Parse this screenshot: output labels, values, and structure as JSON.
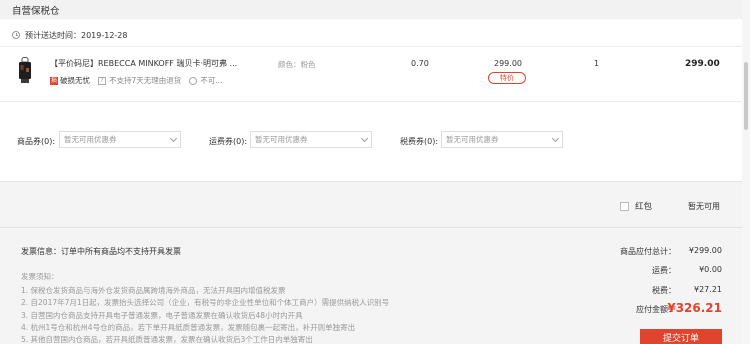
{
  "header": {
    "title": "自营保税仓"
  },
  "delivery": {
    "text": "预计送达时间：2019-12-28"
  },
  "product": {
    "name": "【平价码尼】REBECCA MINKOFF 瑞贝卡·明可弗 ...",
    "tag_break": "破损无忧",
    "tag_break_icon": "损",
    "tag_no_return": "不支持7天无理由退货",
    "tag_no_return_icon": "?",
    "tag_more": "不可...",
    "color": "颜色：粉色",
    "tax": "0.70",
    "price": "299.00",
    "special_badge": "特价",
    "qty": "1",
    "subtotal": "299.00"
  },
  "coupons": {
    "goods_label": "商品券(0):",
    "goods_placeholder": "暂无可用优惠券",
    "shipping_label": "运费券(0):",
    "shipping_placeholder": "暂无可用优惠券",
    "tax_label": "税费券(0):",
    "tax_placeholder": "暂无可用优惠券"
  },
  "red_packet": {
    "label": "红包",
    "status": "暂无可用"
  },
  "invoice": {
    "info": "发票信息：订单中所有商品均不支持开具发票",
    "notes_title": "发票须知：",
    "notes": [
      "1. 保税仓发货商品与海外仓发货商品属跨境海外商品，无法开具国内增值税发票",
      "2. 自2017年7月1日起，发票抬头选择公司（企业，有税号的非企业性单位和个体工商户）需提供纳税人识别号",
      "3. 自营国内仓商品支持开具电子普通发票，电子普通发票在确认收货后48小时内开具",
      "4. 杭州1号仓和杭州4号仓的商品，若下单开具纸质普通发票，发票随包裹一起寄出，补开则单独寄出",
      "5. 其他自营国内仓商品，若开具纸质普通发票，发票在确认收货后3个工作日内单独寄出"
    ]
  },
  "summary": {
    "goods_total_label": "商品应付总计：",
    "goods_total": "¥299.00",
    "shipping_label": "运费：",
    "shipping": "¥0.00",
    "tax_label": "税费：",
    "tax": "¥27.21",
    "payable_label": "应付金额：",
    "payable": "¥326.21",
    "submit_label": "提交订单"
  },
  "colors": {
    "accent": "#e0442f"
  }
}
